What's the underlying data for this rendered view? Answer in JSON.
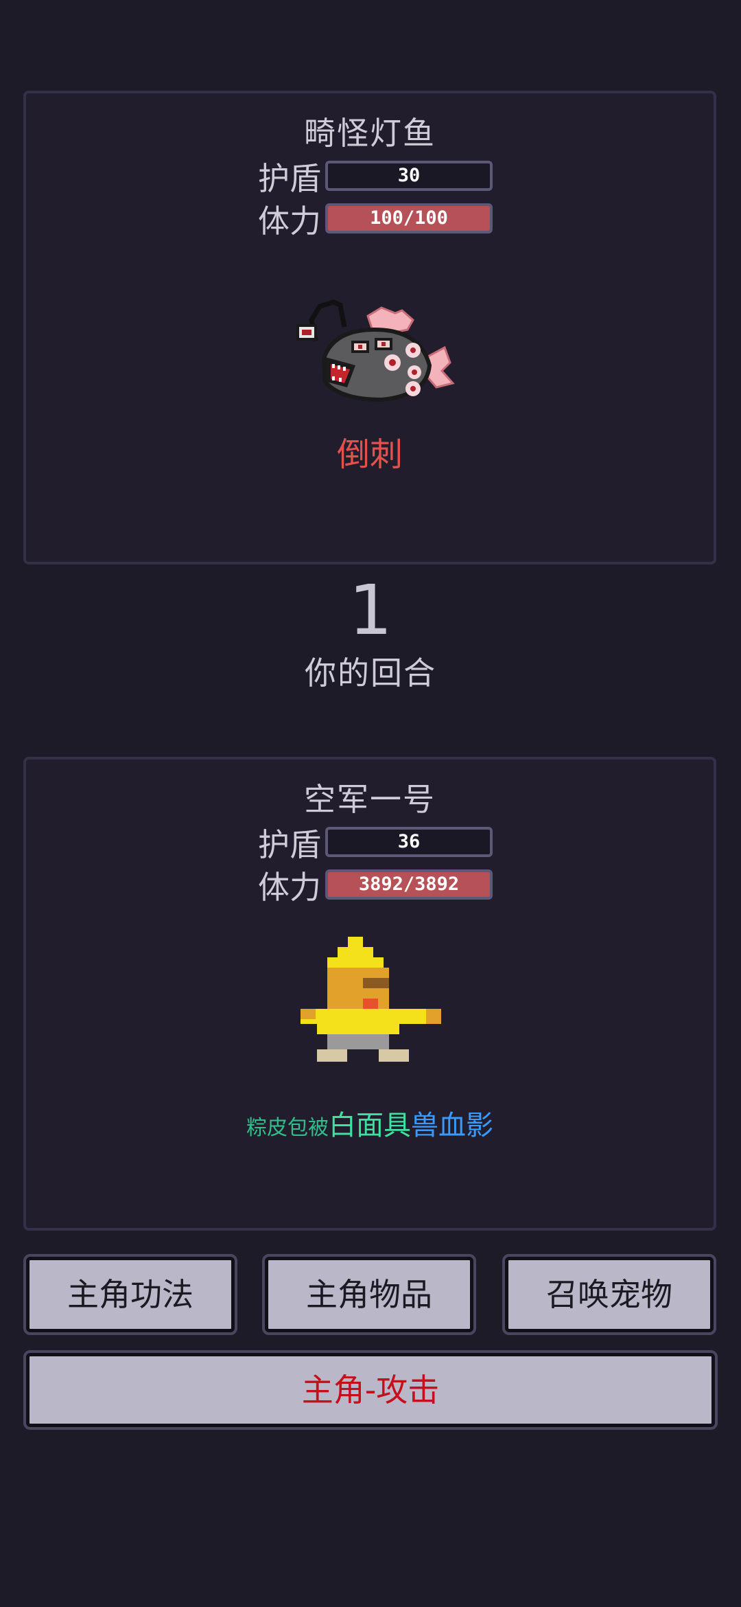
{
  "enemy": {
    "name": "畸怪灯鱼",
    "shield_label": "护盾",
    "shield_value": "30",
    "hp_label": "体力",
    "hp_text": "100/100",
    "hp_fraction": 1.0,
    "status": "倒刺",
    "sprite": "anglerfish-sprite"
  },
  "turn": {
    "number": "1",
    "label": "你的回合"
  },
  "player": {
    "name": "空军一号",
    "shield_label": "护盾",
    "shield_value": "36",
    "hp_label": "体力",
    "hp_text": "3892/3892",
    "hp_fraction": 1.0,
    "sprite": "yellow-hat-character-sprite",
    "equipment": [
      {
        "text": "粽皮包被",
        "color": "#2fbf8a"
      },
      {
        "text": "白面具",
        "color": "#3fe0a0"
      },
      {
        "text": "兽血影",
        "color": "#3a9bff"
      }
    ]
  },
  "buttons": {
    "skills": "主角功法",
    "items": "主角物品",
    "pet": "召唤宠物",
    "attack": "主角-攻击"
  },
  "colors": {
    "background": "#1e1b29",
    "hp_bar": "#b65158",
    "attack_text": "#c4101c",
    "status_red": "#e2524d"
  }
}
